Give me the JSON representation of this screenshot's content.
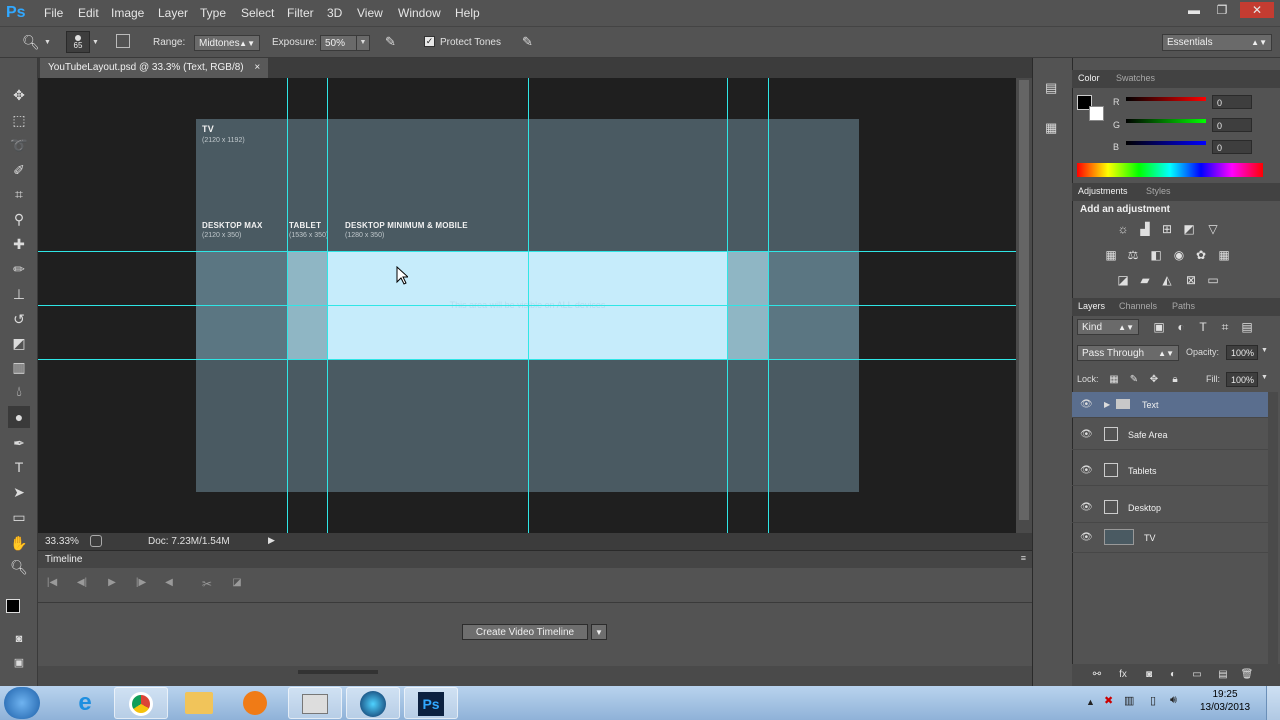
{
  "app": {
    "logo": "Ps"
  },
  "menu": [
    "File",
    "Edit",
    "Image",
    "Layer",
    "Type",
    "Select",
    "Filter",
    "3D",
    "View",
    "Window",
    "Help"
  ],
  "window_controls": {
    "minimize": "▬",
    "restore": "❐",
    "close": "✕"
  },
  "options": {
    "brush_size": "65",
    "range_label": "Range:",
    "range_value": "Midtones",
    "exposure_label": "Exposure:",
    "exposure_value": "50%",
    "protect_tones": "Protect Tones",
    "workspace": "Essentials"
  },
  "document": {
    "tab_title": "YouTubeLayout.psd @ 33.3% (Text, RGB/8)",
    "tab_close": "×",
    "tv_label": "TV",
    "tv_size": "(2120 x 1192)",
    "desktop_max_label": "DESKTOP MAX",
    "desktop_max_size": "(2120 x 350)",
    "tablet_label": "TABLET",
    "tablet_size": "(1536 x 350)",
    "desktop_min_label": "DESKTOP MINIMUM & MOBILE",
    "desktop_min_size": "(1280 x 350)",
    "safe_text": "This area will be visible on ALL devices"
  },
  "status": {
    "zoom": "33.33%",
    "doc": "Doc: 7.23M/1.54M"
  },
  "timeline": {
    "title": "Timeline",
    "create_button": "Create Video Timeline"
  },
  "color_panel": {
    "tabs": [
      "Color",
      "Swatches"
    ],
    "r_label": "R",
    "g_label": "G",
    "b_label": "B",
    "r_value": "0",
    "g_value": "0",
    "b_value": "0"
  },
  "adjustments_panel": {
    "tabs": [
      "Adjustments",
      "Styles"
    ],
    "title": "Add an adjustment"
  },
  "layers_panel": {
    "tabs": [
      "Layers",
      "Channels",
      "Paths"
    ],
    "kind": "Kind",
    "blend_mode": "Pass Through",
    "opacity_label": "Opacity:",
    "opacity_value": "100%",
    "lock_label": "Lock:",
    "fill_label": "Fill:",
    "fill_value": "100%",
    "layers": [
      "Text",
      "Safe Area",
      "Tablets",
      "Desktop",
      "TV"
    ]
  },
  "taskbar": {
    "time": "19:25",
    "date": "13/03/2013"
  },
  "colors": {
    "guide": "#2fe6e6",
    "doc_bg": "#4a5a62",
    "safe_area": "#c6ecfb",
    "tablet_area": "#8fb6c4",
    "desktop_area": "#5b7682",
    "selected_layer": "#5a6e8e"
  }
}
